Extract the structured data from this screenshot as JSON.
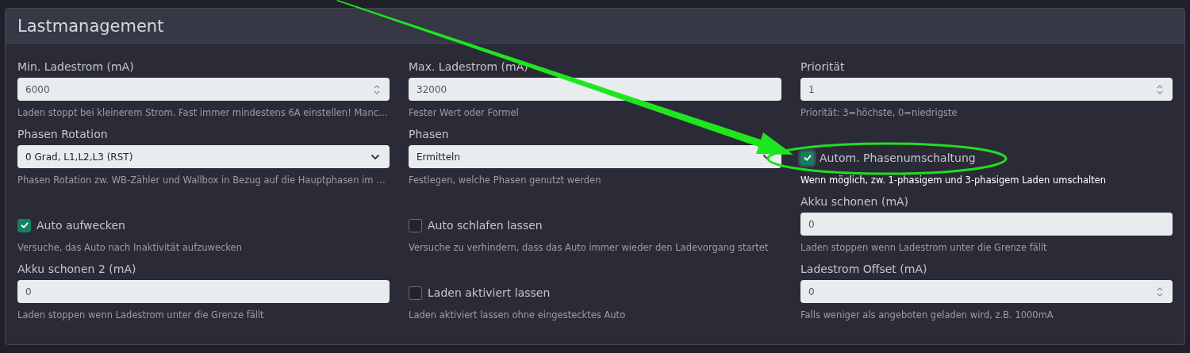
{
  "card": {
    "title": "Lastmanagement"
  },
  "rows": [
    [
      {
        "kind": "number",
        "label": "Min. Ladestrom (mA)",
        "value": "6000",
        "help": "Laden stoppt bei kleinerem Strom. Fast immer mindestens 6A einstellen! Manc…"
      },
      {
        "kind": "text",
        "label": "Max. Ladestrom (mA)",
        "value": "32000",
        "help": "Fester Wert oder Formel"
      },
      {
        "kind": "number",
        "label": "Priorität",
        "value": "1",
        "help": "Priorität: 3=höchste, 0=niedrigste"
      }
    ],
    [
      {
        "kind": "select",
        "label": "Phasen Rotation",
        "value": "0 Grad, L1,L2,L3 (RST)",
        "help": "Phasen Rotation zw. WB-Zähler und Wallbox in Bezug auf die Hauptphasen im …"
      },
      {
        "kind": "select",
        "label": "Phasen",
        "value": "Ermitteln",
        "help": "Festlegen, welche Phasen genutzt werden"
      },
      {
        "kind": "checkbox",
        "label": "Autom. Phasenumschaltung",
        "checked": true,
        "focused": true,
        "help": "Wenn möglich, zw. 1-phasigem und 3-phasigem Laden umschalten"
      }
    ],
    [
      {
        "kind": "checkbox",
        "label": "Auto aufwecken",
        "checked": true,
        "focused": false,
        "help": "Versuche, das Auto nach Inaktivität aufzuwecken"
      },
      {
        "kind": "checkbox",
        "label": "Auto schlafen lassen",
        "checked": false,
        "focused": false,
        "help": "Versuche zu verhindern, dass das Auto immer wieder den Ladevorgang startet"
      },
      {
        "kind": "text",
        "label": "Akku schonen (mA)",
        "value": "0",
        "help": "Laden stoppen wenn Ladestrom unter die Grenze fällt"
      }
    ],
    [
      {
        "kind": "text",
        "label": "Akku schonen 2 (mA)",
        "value": "0",
        "help": "Laden stoppen wenn Ladestrom unter die Grenze fällt"
      },
      {
        "kind": "checkbox",
        "label": "Laden aktiviert lassen",
        "checked": false,
        "focused": false,
        "help": "Laden aktiviert lassen ohne eingestecktes Auto"
      },
      {
        "kind": "number",
        "label": "Ladestrom Offset (mA)",
        "value": "0",
        "help": "Falls weniger als angeboten geladen wird, z.B. 1000mA"
      }
    ]
  ],
  "annotations": [
    {
      "kind": "arrow"
    },
    {
      "kind": "ellipse"
    }
  ]
}
